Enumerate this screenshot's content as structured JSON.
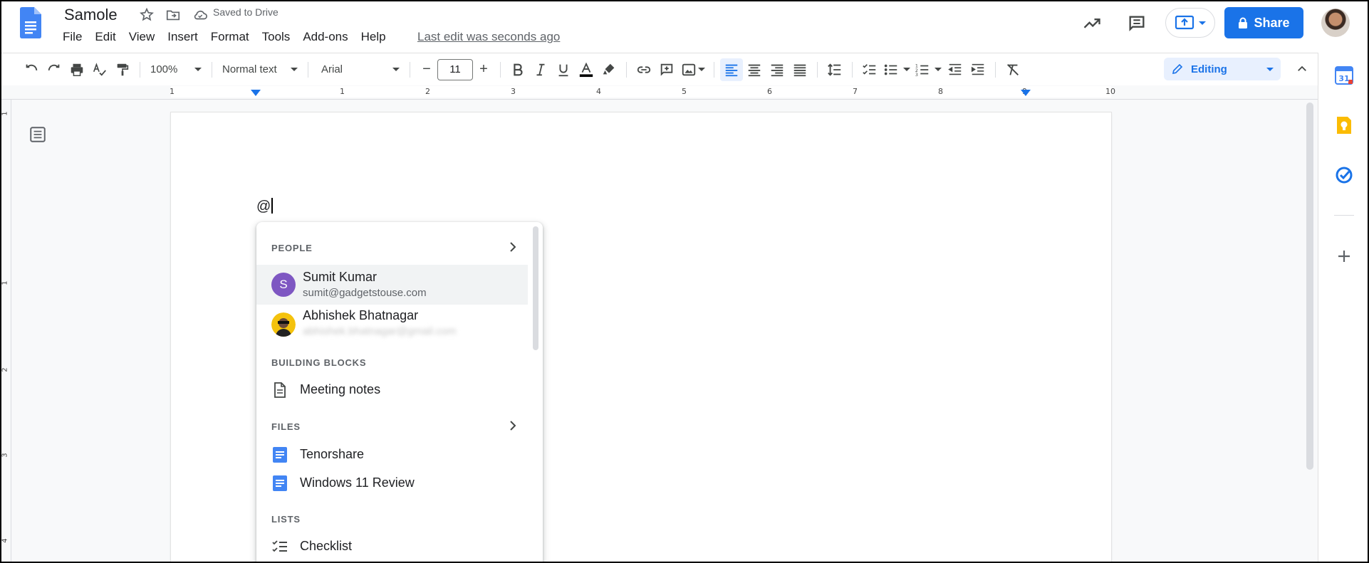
{
  "header": {
    "title": "Samole",
    "saved_status": "Saved to Drive",
    "menu": [
      "File",
      "Edit",
      "View",
      "Insert",
      "Format",
      "Tools",
      "Add-ons",
      "Help"
    ],
    "last_edit": "Last edit was seconds ago",
    "share_label": "Share"
  },
  "toolbar": {
    "zoom": "100%",
    "style": "Normal text",
    "font": "Arial",
    "font_size": "11",
    "mode": "Editing"
  },
  "ruler": {
    "numbers": [
      "1",
      "1",
      "2",
      "3",
      "4",
      "5",
      "6",
      "7",
      "8",
      "9",
      "10"
    ]
  },
  "vruler": {
    "numbers": [
      "1",
      "1",
      "2",
      "3",
      "4"
    ]
  },
  "document": {
    "typed_text": "@"
  },
  "mention_menu": {
    "people_heading": "PEOPLE",
    "people": [
      {
        "name": "Sumit Kumar",
        "email": "sumit@gadgetstouse.com",
        "initial": "S",
        "avatar_color": "#7e57c2"
      },
      {
        "name": "Abhishek Bhatnagar",
        "email": "abhishek.bhatnagar@gmail.com",
        "initial": "",
        "avatar_color": "#f4c20d"
      }
    ],
    "building_blocks_heading": "BUILDING BLOCKS",
    "building_blocks": [
      {
        "label": "Meeting notes",
        "icon": "document-icon"
      }
    ],
    "files_heading": "FILES",
    "files": [
      {
        "label": "Tenorshare",
        "icon": "google-docs-icon"
      },
      {
        "label": "Windows 11 Review",
        "icon": "google-docs-icon"
      }
    ],
    "lists_heading": "LISTS",
    "lists": [
      {
        "label": "Checklist",
        "icon": "checklist-icon"
      }
    ]
  },
  "colors": {
    "accent": "#1a73e8",
    "text_color_bar": "#000000"
  }
}
